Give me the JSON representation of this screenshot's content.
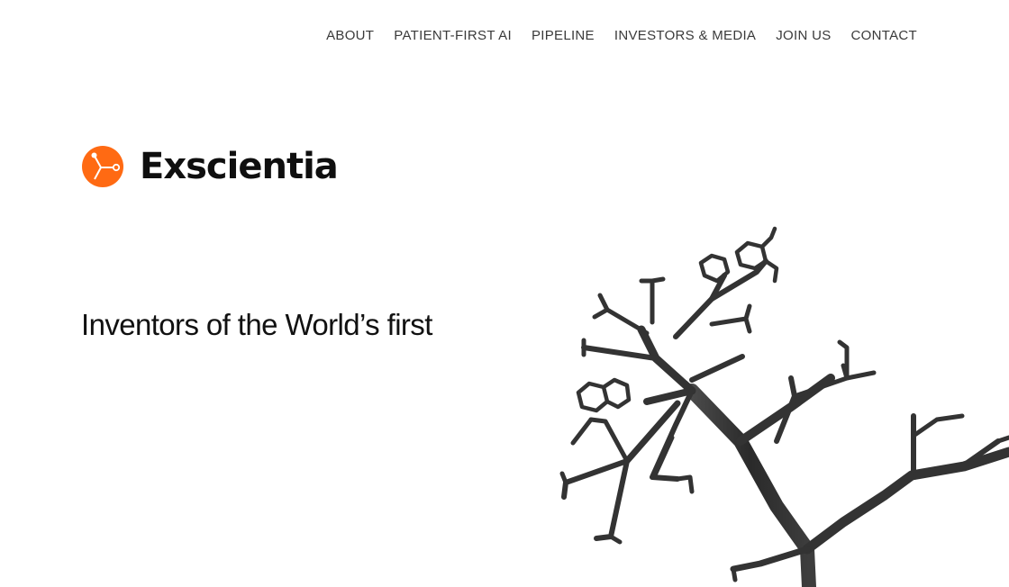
{
  "nav": {
    "items": [
      {
        "label": "ABOUT"
      },
      {
        "label": "PATIENT-FIRST AI"
      },
      {
        "label": "PIPELINE"
      },
      {
        "label": "INVESTORS & MEDIA"
      },
      {
        "label": "JOIN US"
      },
      {
        "label": "CONTACT"
      }
    ]
  },
  "brand": {
    "name": "Exscientia",
    "logo_icon": "molecule-node-icon",
    "accent_color": "#ff6a13"
  },
  "hero": {
    "headline": "Inventors of the World’s first",
    "illustration_icon": "molecular-tree-illustration"
  }
}
